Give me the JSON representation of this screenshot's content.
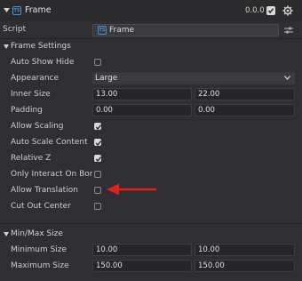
{
  "header": {
    "title": "Frame",
    "ts_badge": "TS",
    "version": "0.0.0",
    "enabled": true
  },
  "script": {
    "label": "Script",
    "value": "Frame",
    "ts_badge": "TS"
  },
  "frame_settings": {
    "title": "Frame Settings",
    "auto_show_hide": {
      "label": "Auto Show Hide",
      "checked": false
    },
    "appearance": {
      "label": "Appearance",
      "value": "Large"
    },
    "inner_size": {
      "label": "Inner Size",
      "x": "13.00",
      "y": "22.00"
    },
    "padding": {
      "label": "Padding",
      "x": "0.00",
      "y": "0.00"
    },
    "allow_scaling": {
      "label": "Allow Scaling",
      "checked": true
    },
    "auto_scale_content": {
      "label": "Auto Scale Content",
      "checked": true
    },
    "relative_z": {
      "label": "Relative Z",
      "checked": true
    },
    "only_interact_on_border": {
      "label": "Only Interact On Bord",
      "checked": false
    },
    "allow_translation": {
      "label": "Allow Translation",
      "checked": false
    },
    "cut_out_center": {
      "label": "Cut Out Center",
      "checked": false
    }
  },
  "min_max_size": {
    "title": "Min/Max Size",
    "minimum_size": {
      "label": "Minimum Size",
      "x": "10.00",
      "y": "10.00"
    },
    "maximum_size": {
      "label": "Maximum Size",
      "x": "150.00",
      "y": "150.00"
    }
  },
  "colors": {
    "panel_bg": "#2f2f33",
    "field_bg": "#262629",
    "accent_blue": "#4a90d9",
    "annotation_red": "#e02020"
  },
  "icons": {
    "collapse": "triangle-down-icon",
    "settings": "gear-icon",
    "script_options": "sliders-icon",
    "annotation": "red-arrow-left"
  }
}
